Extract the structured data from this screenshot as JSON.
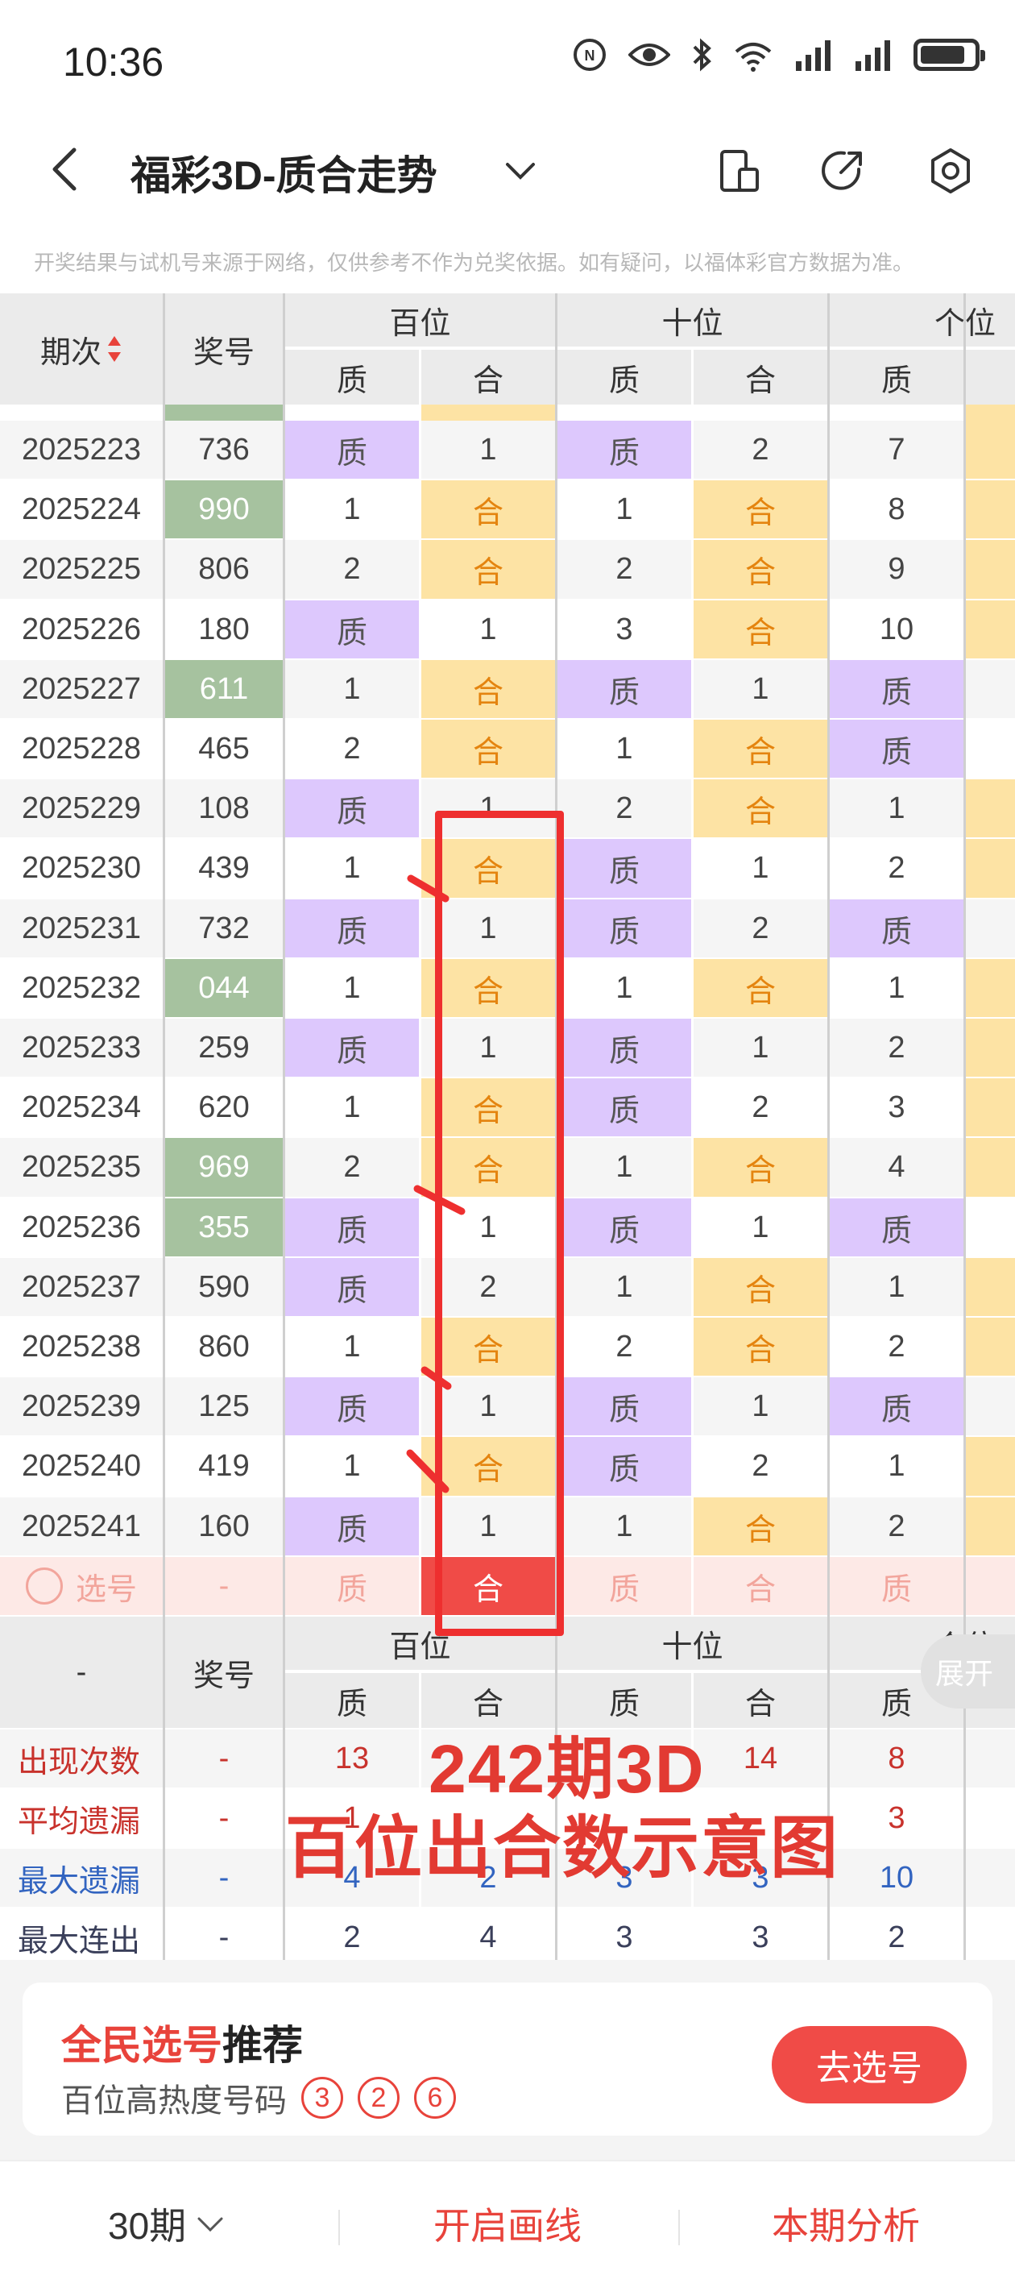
{
  "status": {
    "time": "10:36",
    "battery_level": 0.85
  },
  "nav": {
    "title": "福彩3D-质合走势"
  },
  "disclaimer": "开奖结果与试机号来源于网络，仅供参考不作为兑奖依据。如有疑问，以福体彩官方数据为准。",
  "table": {
    "header": {
      "period": "期次",
      "number": "奖号",
      "hundreds": "百位",
      "tens": "十位",
      "units": "个位",
      "prime": "质",
      "composite": "合"
    },
    "rows": [
      {
        "period": "2025223",
        "num": "736",
        "jackpot": false,
        "h1": "质",
        "h2": "1",
        "t1": "质",
        "t2": "2",
        "u1": "7",
        "u_color": "comp"
      },
      {
        "period": "2025224",
        "num": "990",
        "jackpot": true,
        "h1": "1",
        "h2": "合",
        "t1": "1",
        "t2": "合",
        "u1": "8",
        "u_color": "comp"
      },
      {
        "period": "2025225",
        "num": "806",
        "jackpot": false,
        "h1": "2",
        "h2": "合",
        "t1": "2",
        "t2": "合",
        "u1": "9",
        "u_color": "comp"
      },
      {
        "period": "2025226",
        "num": "180",
        "jackpot": false,
        "h1": "质",
        "h2": "1",
        "t1": "3",
        "t2": "合",
        "u1": "10",
        "u_color": "comp"
      },
      {
        "period": "2025227",
        "num": "611",
        "jackpot": true,
        "h1": "1",
        "h2": "合",
        "t1": "质",
        "t2": "1",
        "u1": "质",
        "u_color": "none"
      },
      {
        "period": "2025228",
        "num": "465",
        "jackpot": false,
        "h1": "2",
        "h2": "合",
        "t1": "1",
        "t2": "合",
        "u1": "质",
        "u_color": "none"
      },
      {
        "period": "2025229",
        "num": "108",
        "jackpot": false,
        "h1": "质",
        "h2": "1",
        "t1": "2",
        "t2": "合",
        "u1": "1",
        "u_color": "comp"
      },
      {
        "period": "2025230",
        "num": "439",
        "jackpot": false,
        "h1": "1",
        "h2": "合",
        "t1": "质",
        "t2": "1",
        "u1": "2",
        "u_color": "comp"
      },
      {
        "period": "2025231",
        "num": "732",
        "jackpot": false,
        "h1": "质",
        "h2": "1",
        "t1": "质",
        "t2": "2",
        "u1": "质",
        "u_color": "none"
      },
      {
        "period": "2025232",
        "num": "044",
        "jackpot": true,
        "h1": "1",
        "h2": "合",
        "t1": "1",
        "t2": "合",
        "u1": "1",
        "u_color": "comp"
      },
      {
        "period": "2025233",
        "num": "259",
        "jackpot": false,
        "h1": "质",
        "h2": "1",
        "t1": "质",
        "t2": "1",
        "u1": "2",
        "u_color": "comp"
      },
      {
        "period": "2025234",
        "num": "620",
        "jackpot": false,
        "h1": "1",
        "h2": "合",
        "t1": "质",
        "t2": "2",
        "u1": "3",
        "u_color": "comp"
      },
      {
        "period": "2025235",
        "num": "969",
        "jackpot": true,
        "h1": "2",
        "h2": "合",
        "t1": "1",
        "t2": "合",
        "u1": "4",
        "u_color": "comp"
      },
      {
        "period": "2025236",
        "num": "355",
        "jackpot": true,
        "h1": "质",
        "h2": "1",
        "t1": "质",
        "t2": "1",
        "u1": "质",
        "u_color": "none"
      },
      {
        "period": "2025237",
        "num": "590",
        "jackpot": false,
        "h1": "质",
        "h2": "2",
        "t1": "1",
        "t2": "合",
        "u1": "1",
        "u_color": "comp"
      },
      {
        "period": "2025238",
        "num": "860",
        "jackpot": false,
        "h1": "1",
        "h2": "合",
        "t1": "2",
        "t2": "合",
        "u1": "2",
        "u_color": "comp"
      },
      {
        "period": "2025239",
        "num": "125",
        "jackpot": false,
        "h1": "质",
        "h2": "1",
        "t1": "质",
        "t2": "1",
        "u1": "质",
        "u_color": "none"
      },
      {
        "period": "2025240",
        "num": "419",
        "jackpot": false,
        "h1": "1",
        "h2": "合",
        "t1": "质",
        "t2": "2",
        "u1": "1",
        "u_color": "comp"
      },
      {
        "period": "2025241",
        "num": "160",
        "jackpot": false,
        "h1": "质",
        "h2": "1",
        "t1": "1",
        "t2": "合",
        "u1": "2",
        "u_color": "comp"
      }
    ],
    "select_row": {
      "label": "选号",
      "num": "-",
      "h1": "质",
      "h2": "合",
      "t1": "质",
      "t2": "合",
      "u1": "质"
    },
    "footer_header": {
      "dash": "-",
      "number": "奖号",
      "hundreds": "百位",
      "tens": "十位",
      "units": "个位",
      "prime": "质",
      "composite": "合"
    },
    "stats": [
      {
        "label": "出现次数",
        "num": "-",
        "h1": "13",
        "h2": "",
        "t1": "",
        "t2": "14",
        "u1": "8",
        "style": "red"
      },
      {
        "label": "平均遗漏",
        "num": "-",
        "h1": "1",
        "h2": "",
        "t1": "",
        "t2": "",
        "u1": "3",
        "style": "red"
      },
      {
        "label": "最大遗漏",
        "num": "-",
        "h1": "4",
        "h2": "2",
        "t1": "3",
        "t2": "3",
        "u1": "10",
        "style": "blue"
      },
      {
        "label": "最大连出",
        "num": "-",
        "h1": "2",
        "h2": "4",
        "t1": "3",
        "t2": "3",
        "u1": "2",
        "style": "dark"
      }
    ],
    "expand_label": "展开"
  },
  "annotation": {
    "line1": "242期3D",
    "line2": "百位出合数示意图"
  },
  "recommend": {
    "title_red": "全民选号",
    "title_black": "推荐",
    "subtitle": "百位高热度号码",
    "numbers": [
      "3",
      "2",
      "6"
    ],
    "button": "去选号"
  },
  "bottom": {
    "periods": "30期",
    "draw_line": "开启画线",
    "analysis": "本期分析"
  },
  "colors": {
    "accent_red": "#f04b47",
    "prime_purple": "#ddc8fd",
    "composite_yellow": "#fde3a4",
    "jackpot_green": "#a6c29f"
  }
}
